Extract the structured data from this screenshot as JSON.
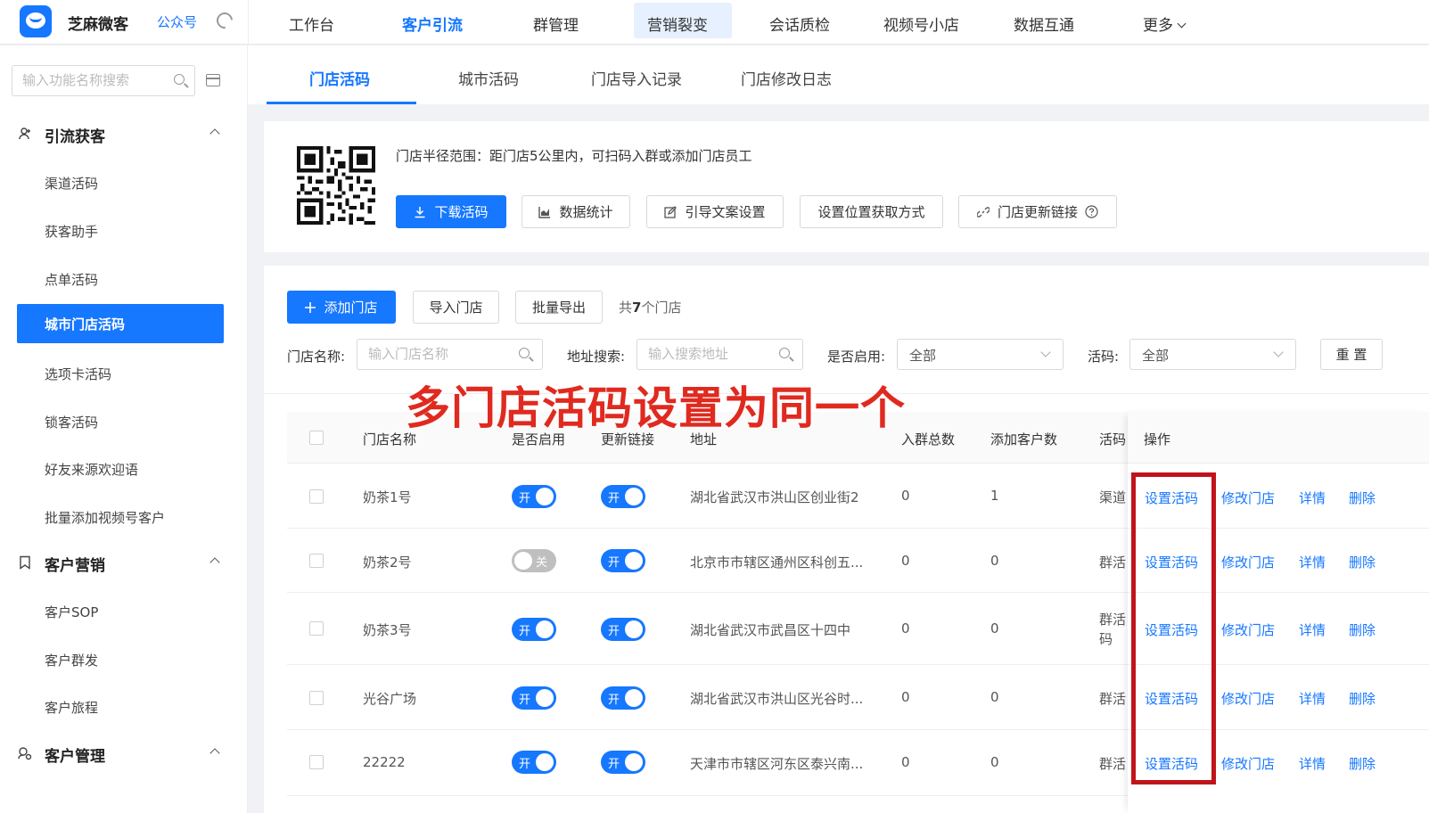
{
  "app": {
    "name": "芝麻微客",
    "account": "公众号"
  },
  "topnav": [
    "工作台",
    "客户引流",
    "群管理",
    "营销裂变",
    "会话质检",
    "视频号小店",
    "数据互通",
    "更多"
  ],
  "sidebar": {
    "search_placeholder": "输入功能名称搜索",
    "groups": [
      {
        "title": "引流获客",
        "items": [
          "渠道活码",
          "获客助手",
          "点单活码",
          "城市门店活码",
          "选项卡活码",
          "锁客活码",
          "好友来源欢迎语",
          "批量添加视频号客户"
        ]
      },
      {
        "title": "客户营销",
        "items": [
          "客户SOP",
          "客户群发",
          "客户旅程"
        ]
      },
      {
        "title": "客户管理",
        "items": []
      }
    ]
  },
  "tabs": [
    "门店活码",
    "城市活码",
    "门店导入记录",
    "门店修改日志"
  ],
  "qr_card": {
    "desc": "门店半径范围：距门店5公里内，可扫码入群或添加门店员工",
    "buttons": [
      "下载活码",
      "数据统计",
      "引导文案设置",
      "设置位置获取方式",
      "门店更新链接"
    ]
  },
  "toolbar": {
    "add": "添加门店",
    "import": "导入门店",
    "export": "批量导出",
    "count_prefix": "共",
    "count": "7",
    "count_suffix": "个门店"
  },
  "filters": {
    "name_label": "门店名称:",
    "name_placeholder": "输入门店名称",
    "addr_label": "地址搜索:",
    "addr_placeholder": "输入搜索地址",
    "enabled_label": "是否启用:",
    "enabled_value": "全部",
    "code_label": "活码:",
    "code_value": "全部",
    "reset": "重 置"
  },
  "annotation": "多门店活码设置为同一个",
  "table": {
    "headers": [
      "门店名称",
      "是否启用",
      "更新链接",
      "地址",
      "入群总数",
      "添加客户数",
      "活码",
      "操作"
    ],
    "rows": [
      {
        "name": "奶茶1号",
        "enabled": "开",
        "update": "开",
        "address": "湖北省武汉市洪山区创业街2",
        "groups": "0",
        "customers": "1",
        "code": "渠道"
      },
      {
        "name": "奶茶2号",
        "enabled": "关",
        "update": "开",
        "address": "北京市市辖区通州区科创五...",
        "groups": "0",
        "customers": "0",
        "code": "群活"
      },
      {
        "name": "奶茶3号",
        "enabled": "开",
        "update": "开",
        "address": "湖北省武汉市武昌区十四中",
        "groups": "0",
        "customers": "0",
        "code": "群活\n码"
      },
      {
        "name": "光谷广场",
        "enabled": "开",
        "update": "开",
        "address": "湖北省武汉市洪山区光谷时...",
        "groups": "0",
        "customers": "0",
        "code": "群活"
      },
      {
        "name": "22222",
        "enabled": "开",
        "update": "开",
        "address": "天津市市辖区河东区泰兴南...",
        "groups": "0",
        "customers": "0",
        "code": "群活"
      }
    ],
    "actions": [
      "设置活码",
      "修改门店",
      "详情",
      "删除"
    ]
  },
  "colors": {
    "primary": "#1677ff",
    "annotation": "#e02a1f",
    "highlight_box": "#c0141b"
  }
}
